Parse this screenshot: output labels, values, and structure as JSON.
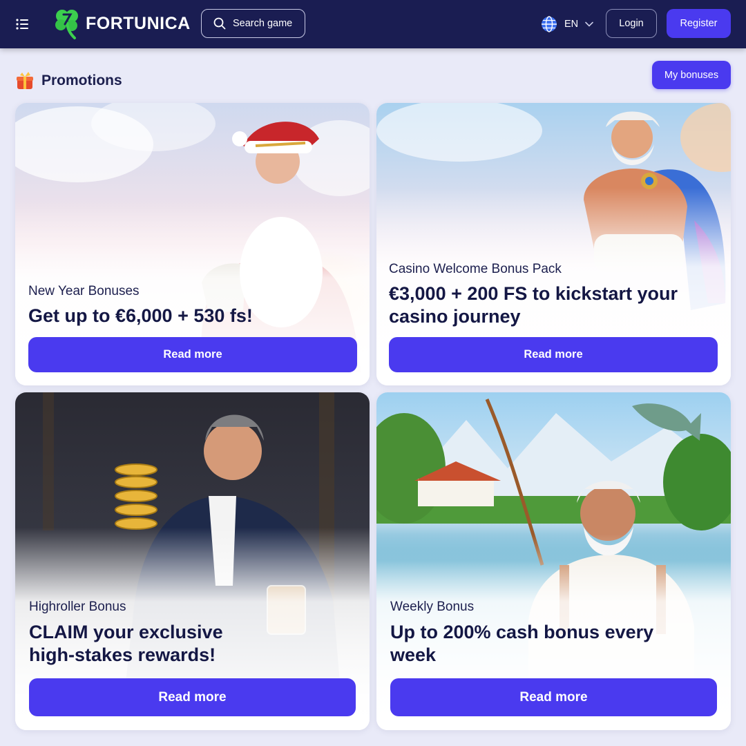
{
  "header": {
    "brand": "FORTUNICA",
    "search_label": "Search game",
    "language": "EN",
    "login_label": "Login",
    "register_label": "Register"
  },
  "page": {
    "title": "Promotions",
    "my_bonuses_label": "My bonuses"
  },
  "promotions": [
    {
      "subtitle": "New Year Bonuses",
      "headline": "Get up to €6,000 + 530 fs!",
      "cta": "Read more"
    },
    {
      "subtitle": "Casino Welcome Bonus Pack",
      "headline": "€3,000 + 200 FS to kickstart your casino journey",
      "cta": "Read more"
    },
    {
      "subtitle": "Highroller Bonus",
      "headline": "CLAIM your exclusive high-stakes rewards!",
      "cta": "Read more"
    },
    {
      "subtitle": "Weekly Bonus",
      "headline": "Up to 200% cash bonus every week",
      "cta": "Read more"
    }
  ],
  "colors": {
    "header_bg": "#1a1d52",
    "accent": "#4a3aef",
    "page_bg": "#e9eaf8",
    "logo_green": "#3ccf4e"
  }
}
